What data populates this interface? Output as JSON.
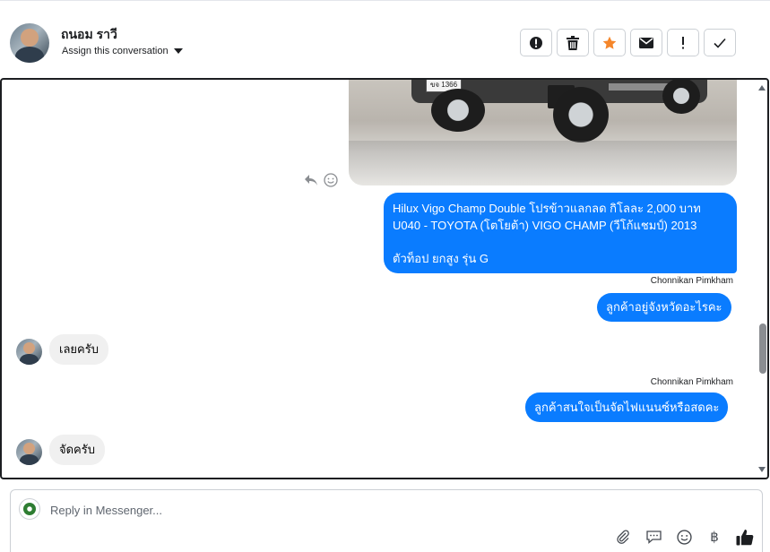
{
  "header": {
    "contact_name": "ถนอม ราวี",
    "assign_label": "Assign this conversation"
  },
  "actions": [
    {
      "name": "mark-spam-button",
      "icon": "alert-circle-icon"
    },
    {
      "name": "delete-button",
      "icon": "trash-icon"
    },
    {
      "name": "star-button",
      "icon": "star-icon",
      "color": "#f5862a"
    },
    {
      "name": "mark-unread-button",
      "icon": "envelope-icon"
    },
    {
      "name": "follow-up-button",
      "icon": "exclamation-icon"
    },
    {
      "name": "mark-done-button",
      "icon": "check-icon"
    }
  ],
  "photo": {
    "plate_text": "ขจ 1366"
  },
  "messages": [
    {
      "direction": "outgoing",
      "lines": [
        "Hilux Vigo Champ Double โปรข้าวแลกลด กิโลละ 2,000 บาท",
        "U040 - TOYOTA (โตโยต้า) VIGO CHAMP (วีโก้แชมป์) 2013",
        "",
        " ตัวท็อป ยกสูง รุ่น G"
      ]
    },
    {
      "direction": "sender_label",
      "text": "Chonnikan Pimkham"
    },
    {
      "direction": "outgoing",
      "text": "ลูกค้าอยู่จังหวัดอะไรคะ"
    },
    {
      "direction": "incoming",
      "text": "เลยครับ"
    },
    {
      "direction": "sender_label",
      "text": "Chonnikan Pimkham"
    },
    {
      "direction": "outgoing",
      "text": "ลูกค้าสนใจเป็นจัดไฟแนนซ์หรือสดคะ"
    },
    {
      "direction": "incoming",
      "text": "จัดครับ"
    }
  ],
  "composer": {
    "placeholder": "Reply in Messenger...",
    "currency_symbol": "฿"
  },
  "colors": {
    "outgoing_bubble": "#0a7cff",
    "incoming_bubble": "#f0f0f0",
    "star_accent": "#f5862a"
  }
}
